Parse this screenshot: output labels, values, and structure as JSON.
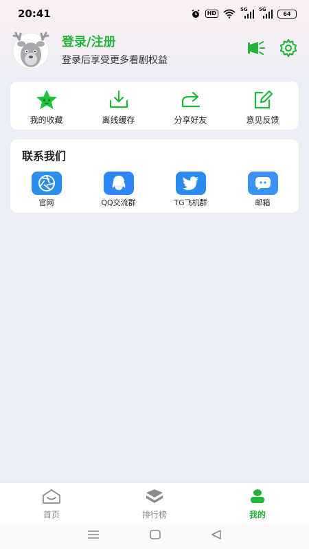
{
  "status_bar": {
    "time": "20:41",
    "hd_label": "HD",
    "signal1_label": "5G",
    "signal2_label": "5G",
    "battery": "64",
    "icons": [
      "alarm-icon",
      "hd-icon",
      "wifi-icon",
      "signal-icon",
      "signal-icon",
      "battery-icon"
    ]
  },
  "profile": {
    "title": "登录/注册",
    "subtitle": "登录后享受更多看剧权益",
    "avatar_icon": "deer-avatar",
    "actions": [
      "announcement-icon",
      "settings-icon"
    ]
  },
  "quick_actions": [
    {
      "label": "我的收藏",
      "icon": "star-icon"
    },
    {
      "label": "离线缓存",
      "icon": "download-icon"
    },
    {
      "label": "分享好友",
      "icon": "share-icon"
    },
    {
      "label": "意见反馈",
      "icon": "edit-icon"
    }
  ],
  "contact": {
    "title": "联系我们",
    "items": [
      {
        "label": "官网",
        "icon": "aperture-icon",
        "color": "#2b8ff0"
      },
      {
        "label": "QQ交流群",
        "icon": "qq-icon",
        "color": "#2f86f6"
      },
      {
        "label": "TG飞机群",
        "icon": "twitter-icon",
        "color": "#2c8bef"
      },
      {
        "label": "邮箱",
        "icon": "message-icon",
        "color": "#3a93f2"
      }
    ]
  },
  "bottom_nav": [
    {
      "label": "首页",
      "icon": "home-icon",
      "active": false
    },
    {
      "label": "排行榜",
      "icon": "ranking-icon",
      "active": false
    },
    {
      "label": "我的",
      "icon": "profile-icon",
      "active": true
    }
  ],
  "colors": {
    "accent": "#22b53a",
    "contact_blue": "#2b8ff0",
    "background": "#eceef6"
  }
}
